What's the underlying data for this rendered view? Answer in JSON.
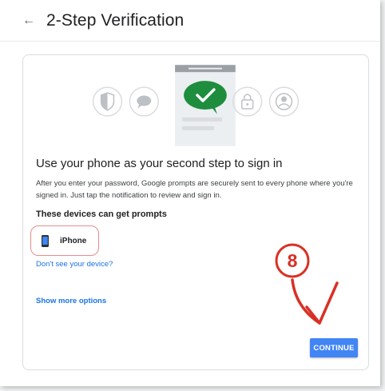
{
  "header": {
    "back_icon": "arrow-left-icon",
    "title": "2-Step Verification"
  },
  "illustration": {
    "icons": [
      "shield-icon",
      "chat-bubble-icon",
      "check-bubble-icon",
      "lock-icon",
      "account-icon"
    ],
    "accent_color": "#1e8e3e"
  },
  "card": {
    "heading": "Use your phone as your second step to sign in",
    "description": "After you enter your password, Google prompts are securely sent to every phone where you're signed in. Just tap the notification to review and sign in.",
    "devices_title": "These devices can get prompts",
    "device": {
      "icon": "smartphone-icon",
      "name": "iPhone"
    },
    "dont_see_link": "Don't see your device?",
    "show_more_link": "Show more options",
    "continue_button": "CONTINUE"
  },
  "annotation": {
    "step_number": "8",
    "color": "#d93025"
  }
}
